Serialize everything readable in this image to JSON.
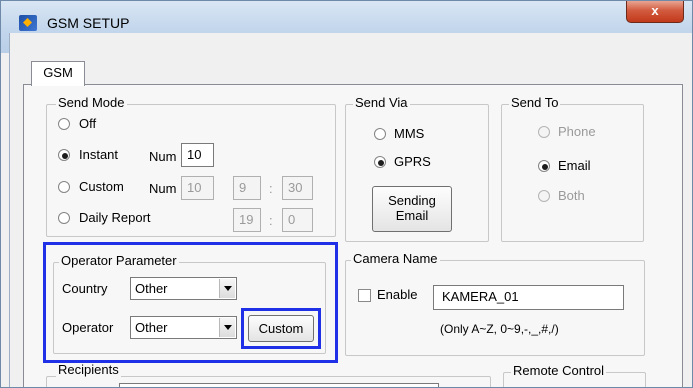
{
  "window": {
    "title": "GSM SETUP",
    "close_glyph": "x"
  },
  "tabs": [
    {
      "label": "GSM"
    }
  ],
  "send_mode": {
    "legend": "Send Mode",
    "options": {
      "off": "Off",
      "instant": "Instant",
      "custom": "Custom",
      "daily": "Daily Report"
    },
    "selected": "Instant",
    "num_label": "Num",
    "instant_num": "10",
    "custom_num": "10",
    "custom_hour": "9",
    "custom_minute": "30",
    "daily_hour": "19",
    "daily_minute": "0",
    "time_separator": ":"
  },
  "send_via": {
    "legend": "Send Via",
    "options": {
      "mms": "MMS",
      "gprs": "GPRS"
    },
    "selected": "GPRS",
    "sending_email_line1": "Sending",
    "sending_email_line2": "Email"
  },
  "send_to": {
    "legend": "Send To",
    "options": {
      "phone": "Phone",
      "email": "Email",
      "both": "Both"
    },
    "selected": "Email",
    "disabled": [
      "Phone",
      "Both"
    ]
  },
  "operator_parameter": {
    "legend": "Operator Parameter",
    "country_label": "Country",
    "country_value": "Other",
    "operator_label": "Operator",
    "operator_value": "Other",
    "custom_button": "Custom"
  },
  "camera_name": {
    "legend": "Camera Name",
    "enable_label": "Enable",
    "enabled": false,
    "value": "KAMERA_01",
    "hint": "(Only A~Z, 0~9,-,_,#,/)"
  },
  "recipients": {
    "legend": "Recipients"
  },
  "remote_control": {
    "legend": "Remote Control"
  },
  "colors": {
    "highlight": "#1f30e6",
    "title_bar": "#c3d6ec",
    "close_button": "#c2391b"
  }
}
